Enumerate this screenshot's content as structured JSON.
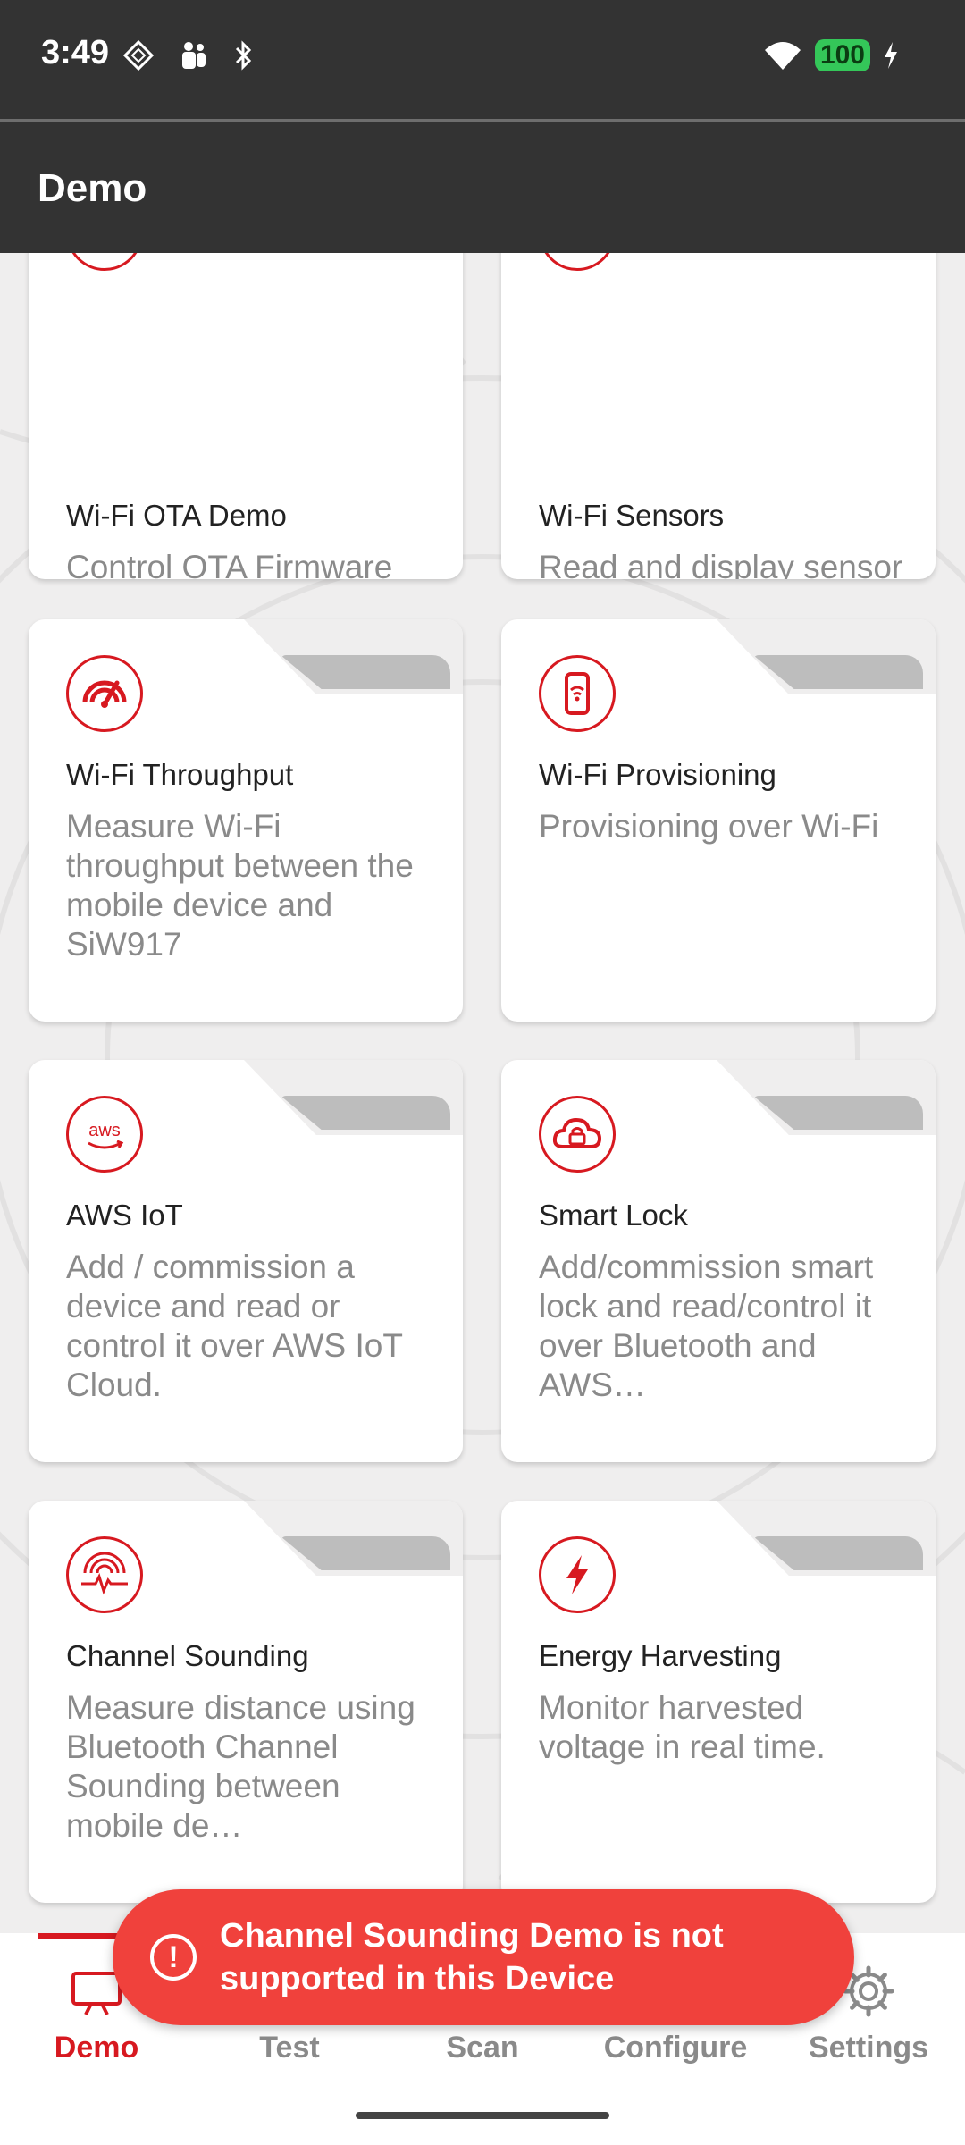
{
  "status_bar": {
    "time": "3:49",
    "battery": "100"
  },
  "app_bar": {
    "title": "Demo"
  },
  "cards": [
    {
      "title": "Wi-Fi OTA Demo",
      "description": "Control OTA Firmware update over Wi-Fi.",
      "icon": "ota-icon"
    },
    {
      "title": "Wi-Fi Sensors",
      "description": "Read and display sensor data from the dev kit sensors.",
      "icon": "sensor-icon"
    },
    {
      "title": "Wi-Fi Throughput",
      "description": "Measure Wi-Fi throughput between the mobile device and SiW917",
      "icon": "speedometer-wifi-icon"
    },
    {
      "title": "Wi-Fi Provisioning",
      "description": "Provisioning over Wi-Fi",
      "icon": "phone-wifi-icon"
    },
    {
      "title": "AWS IoT",
      "description": "Add / commission a device and read or control it over AWS IoT Cloud.",
      "icon": "aws-icon"
    },
    {
      "title": "Smart Lock",
      "description": "Add/commission smart lock and read/control it over Bluetooth and AWS…",
      "icon": "cloud-lock-icon"
    },
    {
      "title": "Channel Sounding",
      "description": "Measure distance using Bluetooth Channel Sounding between mobile de…",
      "icon": "signal-wave-icon"
    },
    {
      "title": "Energy Harvesting",
      "description": "Monitor harvested voltage in real time.",
      "icon": "lightning-icon"
    }
  ],
  "snackbar": {
    "message": "Channel Sounding Demo is not supported in this Device"
  },
  "bottom_nav": {
    "items": [
      {
        "label": "Demo",
        "icon": "display-icon",
        "active": true
      },
      {
        "label": "Test",
        "icon": "test-icon",
        "active": false
      },
      {
        "label": "Scan",
        "icon": "scan-icon",
        "active": false
      },
      {
        "label": "Configure",
        "icon": "tools-icon",
        "active": false
      },
      {
        "label": "Settings",
        "icon": "gear-icon",
        "active": false
      }
    ]
  },
  "colors": {
    "accent": "#d71920",
    "app_bar": "#333333",
    "snackbar": "#f0413c",
    "background": "#efeeee"
  }
}
